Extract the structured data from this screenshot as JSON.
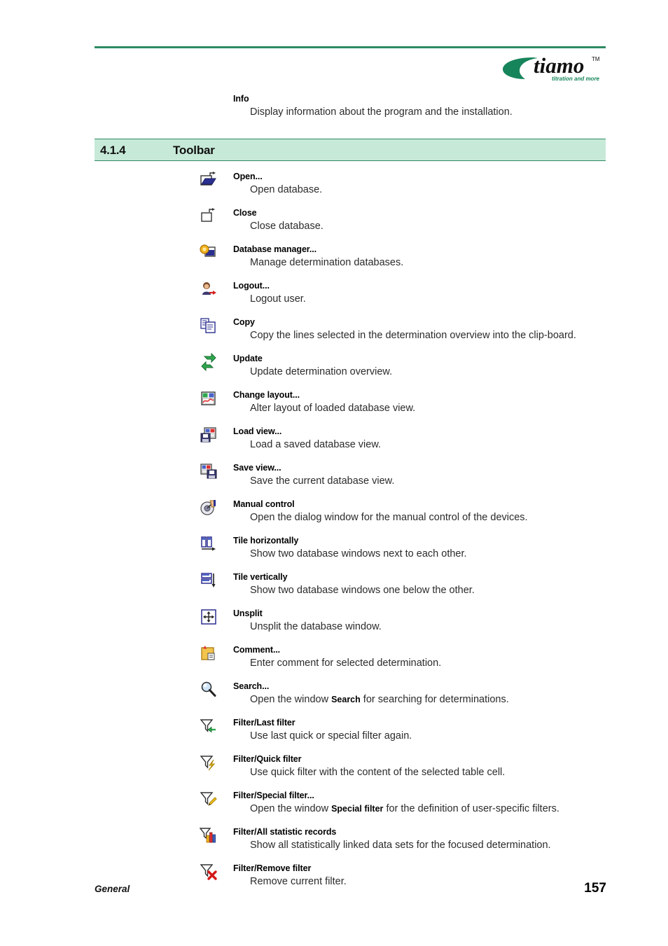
{
  "brand": {
    "logo_text": "tiamo",
    "logo_tm": "TM",
    "tagline": "titration and more",
    "logo_green": "#17855c",
    "rule_green": "#2e8b63"
  },
  "intro": {
    "label": "Info",
    "description": "Display information about the program and the installation."
  },
  "section": {
    "number": "4.1.4",
    "title": "Toolbar",
    "band_color": "#c7e9d8"
  },
  "entries": [
    {
      "icon": "open-folder-icon",
      "label": "Open...",
      "description": "Open database."
    },
    {
      "icon": "close-folder-icon",
      "label": "Close",
      "description": "Close database."
    },
    {
      "icon": "database-manager-icon",
      "label": "Database manager...",
      "description": "Manage determination databases."
    },
    {
      "icon": "logout-user-icon",
      "label": "Logout...",
      "description": "Logout user."
    },
    {
      "icon": "copy-documents-icon",
      "label": "Copy",
      "description": "Copy the lines selected in the determination overview into the clip-board."
    },
    {
      "icon": "update-refresh-icon",
      "label": "Update",
      "description": "Update determination overview."
    },
    {
      "icon": "change-layout-icon",
      "label": "Change layout...",
      "description": "Alter layout of loaded database view."
    },
    {
      "icon": "load-view-icon",
      "label": "Load view...",
      "description": "Load a saved database view."
    },
    {
      "icon": "save-view-icon",
      "label": "Save view...",
      "description": "Save the current database view."
    },
    {
      "icon": "manual-control-icon",
      "label": "Manual control",
      "description": "Open the dialog window for the manual control of the devices."
    },
    {
      "icon": "tile-horizontally-icon",
      "label": "Tile horizontally",
      "description": "Show two database windows next to each other."
    },
    {
      "icon": "tile-vertically-icon",
      "label": "Tile vertically",
      "description": "Show two database windows one below the other."
    },
    {
      "icon": "unsplit-icon",
      "label": "Unsplit",
      "description": "Unsplit the database window."
    },
    {
      "icon": "comment-note-icon",
      "label": "Comment...",
      "description": "Enter comment for selected determination."
    },
    {
      "icon": "search-magnifier-icon",
      "label": "Search...",
      "description_pre": "Open the window ",
      "description_bold": "Search",
      "description_post": " for searching for determinations."
    },
    {
      "icon": "filter-last-icon",
      "label": "Filter/Last filter",
      "description": "Use last quick or special filter again."
    },
    {
      "icon": "filter-quick-icon",
      "label": "Filter/Quick filter",
      "description": "Use quick filter with the content of the selected table cell."
    },
    {
      "icon": "filter-special-icon",
      "label": "Filter/Special filter...",
      "description_pre": "Open the window ",
      "description_bold": "Special filter",
      "description_post": " for the definition of user-specific filters."
    },
    {
      "icon": "filter-statistics-icon",
      "label": "Filter/All statistic records",
      "description": "Show all statistically linked data sets for the focused determination."
    },
    {
      "icon": "filter-remove-icon",
      "label": "Filter/Remove filter",
      "description": "Remove current filter."
    }
  ],
  "footer": {
    "chapter": "General",
    "page_number": "157"
  }
}
